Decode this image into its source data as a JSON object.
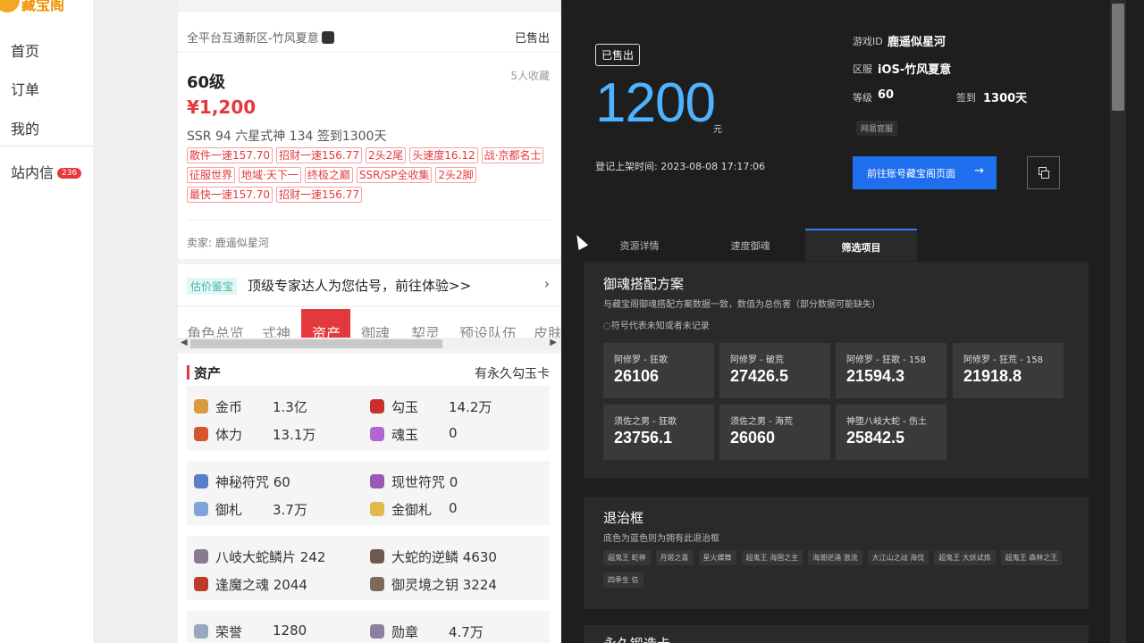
{
  "nav": {
    "logo": "藏宝阁",
    "items": [
      "首页",
      "订单",
      "我的"
    ],
    "inbox": "站内信",
    "inbox_count": "236"
  },
  "product": {
    "server": "全平台互通新区-竹风夏意",
    "status": "已售出",
    "level": "60级",
    "favorites": "5人收藏",
    "price": "¥1,200",
    "summary": "SSR 94   六星式神 134   签到1300天",
    "tags": [
      "散件一速157.70",
      "招财一速156.77",
      "2头2尾",
      "头速度16.12",
      "战·京都名士",
      "征服世界",
      "地域·天下一",
      "终极之巅",
      "SSR/SP全收集",
      "2头2脚",
      "最快一速157.70",
      "招财一速156.77"
    ],
    "seller": "卖家: 鹿遥似星河"
  },
  "appraise": {
    "tag": "估价鉴宝",
    "text": "顶级专家达人为您估号，前往体验>>",
    "arrow": "›"
  },
  "tabs": [
    "角色总览",
    "式神",
    "资产",
    "御魂",
    "契灵",
    "预设队伍",
    "皮肤"
  ],
  "assets": {
    "title": "资产",
    "right": "有永久勾玉卡",
    "groups": [
      [
        {
          "name": "金币",
          "value": "1.3亿",
          "color": "#d89b3c"
        },
        {
          "name": "勾玉",
          "value": "14.2万",
          "color": "#c9302c"
        },
        {
          "name": "体力",
          "value": "13.1万",
          "color": "#d9532b"
        },
        {
          "name": "魂玉",
          "value": "0",
          "color": "#b266d6"
        }
      ],
      [
        {
          "name": "神秘符咒 60",
          "value": "",
          "color": "#5a7fc9"
        },
        {
          "name": "现世符咒 0",
          "value": "",
          "color": "#9b59b6"
        },
        {
          "name": "御札",
          "value": "3.7万",
          "color": "#7fa3d6"
        },
        {
          "name": "金御札",
          "value": "0",
          "color": "#e0b84c"
        }
      ],
      [
        {
          "name": "八岐大蛇鳞片 242",
          "value": "",
          "color": "#8a7a8f"
        },
        {
          "name": "大蛇的逆鳞 4630",
          "value": "",
          "color": "#6e5a4f"
        },
        {
          "name": "逢魔之魂 2044",
          "value": "",
          "color": "#c0392b"
        },
        {
          "name": "御灵境之钥 3224",
          "value": "",
          "color": "#7d6a5a"
        }
      ],
      [
        {
          "name": "荣誉",
          "value": "1280",
          "color": "#9aa7c0"
        },
        {
          "name": "勋章",
          "value": "4.7万",
          "color": "#8c7fa0"
        }
      ]
    ]
  },
  "detail": {
    "status_badge": "已售出",
    "price": "1200",
    "unit": "元",
    "listed": "登记上架时间:   2023-08-08 17:17:06",
    "game_id_label": "游戏ID",
    "game_id": "鹿遥似星河",
    "server_label": "区服",
    "server": "iOS-竹风夏意",
    "level_label": "等级",
    "level": "60",
    "signin_label": "签到",
    "signin": "1300天",
    "official": "网易官服",
    "goto": "前往账号藏宝阁页面",
    "goto_arrow": "→",
    "tabs": [
      "资源详情",
      "速度御魂",
      "筛选项目"
    ],
    "plan": {
      "title": "御魂搭配方案",
      "sub": "与藏宝阁御魂搭配方案数据一致，数值为总伤害（部分数据可能缺失）",
      "note": "◌符号代表未知或者未记录",
      "stats": [
        {
          "label": "阿修罗 - 狂歌",
          "value": "26106"
        },
        {
          "label": "阿修罗 - 破荒",
          "value": "27426.5"
        },
        {
          "label": "阿修罗 - 狂歌 - 158",
          "value": "21594.3"
        },
        {
          "label": "阿修罗 - 狂荒 - 158",
          "value": "21918.8"
        },
        {
          "label": "须佐之男 - 狂歌",
          "value": "23756.1"
        },
        {
          "label": "须佐之男 - 海荒",
          "value": "26060"
        },
        {
          "label": "神堕八岐大蛇 - 伤土",
          "value": "25842.5"
        }
      ]
    },
    "frames": {
      "title": "退治框",
      "sub": "底色为蓝色则为拥有此退治框",
      "items": [
        "超鬼王 蛇神",
        "月姬之喜",
        "星火蝶舞",
        "超鬼王 海国之主",
        "海潮逆涌 激流",
        "大江山之战 海伐",
        "超鬼王 大妖试炼",
        "超鬼王 森林之王",
        "四季生 信"
      ]
    },
    "next_title": "永久锻造卡"
  }
}
